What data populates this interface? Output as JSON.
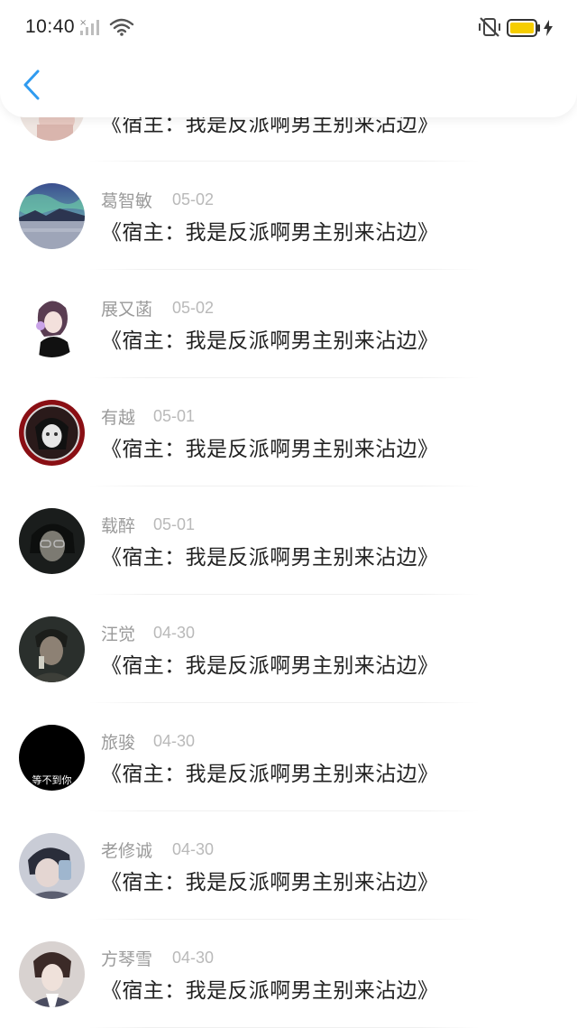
{
  "status_bar": {
    "time": "10:40",
    "icons": [
      "signal-x-icon",
      "wifi-icon",
      "vibrate-mute-icon",
      "battery-icon",
      "charging-bolt-icon"
    ],
    "battery_color": "#f5cd00"
  },
  "nav": {
    "back_icon": "chevron-left-icon",
    "accent_color": "#2f9bf0"
  },
  "comments": [
    {
      "name": "",
      "date": "",
      "text": "《宿主：我是反派啊男主别来沾边》"
    },
    {
      "name": "葛智敏",
      "date": "05-02",
      "text": "《宿主：我是反派啊男主别来沾边》"
    },
    {
      "name": "展又菡",
      "date": "05-02",
      "text": "《宿主：我是反派啊男主别来沾边》"
    },
    {
      "name": "有越",
      "date": "05-01",
      "text": "《宿主：我是反派啊男主别来沾边》"
    },
    {
      "name": "载醉",
      "date": "05-01",
      "text": "《宿主：我是反派啊男主别来沾边》"
    },
    {
      "name": "汪觉",
      "date": "04-30",
      "text": "《宿主：我是反派啊男主别来沾边》"
    },
    {
      "name": "旅骏",
      "date": "04-30",
      "text": "《宿主：我是反派啊男主别来沾边》",
      "avatar_caption": "等不到你"
    },
    {
      "name": "老修诚",
      "date": "04-30",
      "text": "《宿主：我是反派啊男主别来沾边》"
    },
    {
      "name": "方琴雪",
      "date": "04-30",
      "text": "《宿主：我是反派啊男主别来沾边》"
    }
  ]
}
